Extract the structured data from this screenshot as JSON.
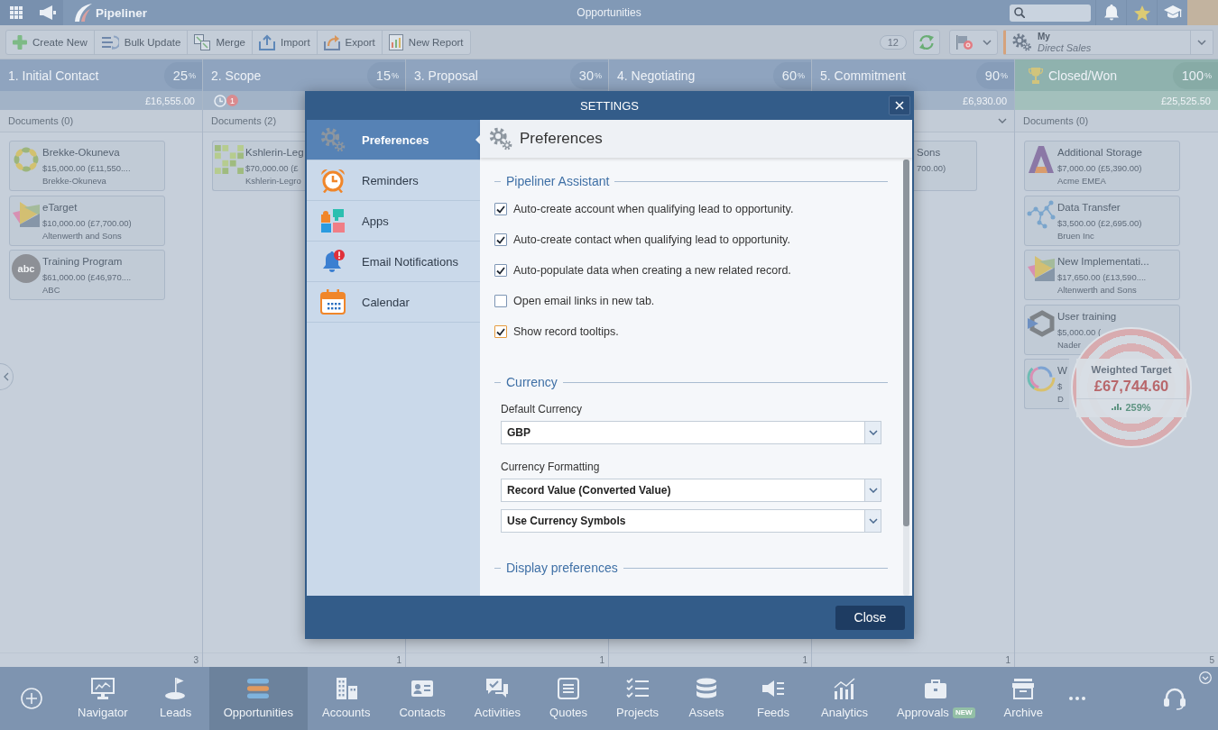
{
  "top_bar": {
    "logo": "Pipeliner",
    "title": "Opportunities"
  },
  "toolbar": {
    "buttons": [
      "Create New",
      "Bulk Update",
      "Merge",
      "Import",
      "Export",
      "New Report"
    ],
    "count": "12",
    "profile": {
      "title": "My",
      "subtitle": "Direct Sales"
    }
  },
  "columns": [
    {
      "kind": "stage",
      "name": "1. Initial Contact",
      "percent": "25",
      "percent_sign": "%",
      "total": "£16,555.00",
      "documents": "Documents (0)",
      "documents_toggle": false,
      "count": "3",
      "cards": [
        {
          "kind": "full",
          "title": "Brekke-Okuneva",
          "amount": "$15,000.00 (£11,550....",
          "account": "Brekke-Okuneva"
        },
        {
          "kind": "full",
          "title": "eTarget",
          "amount": "$10,000.00 (£7,700.00)",
          "account": "Altenwerth and Sons"
        },
        {
          "kind": "full",
          "logo_text": "abc",
          "title": "Training Program",
          "amount": "$61,000.00 (£46,970....",
          "account": "ABC"
        }
      ]
    },
    {
      "kind": "stage",
      "name": "2. Scope",
      "percent": "15",
      "percent_sign": "%",
      "alerts": "1",
      "documents": "Documents (2)",
      "count": "1",
      "cards": [
        {
          "kind": "cut-right",
          "title": "Kshlerin-Leg",
          "amount": "$70,000.00 (£",
          "account": "Kshlerin-Legro"
        }
      ]
    },
    {
      "kind": "stage",
      "name": "3. Proposal",
      "percent": "30",
      "percent_sign": "%",
      "count": "1"
    },
    {
      "kind": "stage",
      "name": "4. Negotiating",
      "percent": "60",
      "percent_sign": "%",
      "count": "1"
    },
    {
      "kind": "stage",
      "name": "5. Commitment",
      "percent": "90",
      "percent_sign": "%",
      "total": "£6,930.00",
      "documents_toggle": true,
      "count": "1",
      "cards": [
        {
          "kind": "cut-left",
          "title": "Sons",
          "amount": "700.00)"
        }
      ]
    },
    {
      "kind": "won",
      "name": "Closed/Won",
      "percent": "100",
      "percent_sign": "%",
      "total": "£25,525.50",
      "documents": "Documents (0)",
      "documents_toggle": false,
      "count": "5",
      "cards": [
        {
          "kind": "full",
          "title": "Additional Storage",
          "amount": "$7,000.00 (£5,390.00)",
          "account": "Acme EMEA"
        },
        {
          "kind": "full",
          "title": "Data Transfer",
          "amount": "$3,500.00 (£2,695.00)",
          "account": "Bruen Inc"
        },
        {
          "kind": "full",
          "title": "New Implementati...",
          "amount": "$17,650.00 (£13,590....",
          "account": "Altenwerth and Sons"
        },
        {
          "kind": "full",
          "title": "User training",
          "amount": "$5,000.00 (",
          "account": "Nader"
        },
        {
          "kind": "covered",
          "title": "W",
          "amount": "$",
          "account": "D"
        }
      ]
    }
  ],
  "weighted_target": {
    "title": "Weighted Target",
    "value": "£67,744.60",
    "percent": "259%"
  },
  "dialog": {
    "title": "SETTINGS",
    "nav": [
      {
        "label": "Preferences",
        "selected": true
      },
      {
        "label": "Reminders",
        "selected": false
      },
      {
        "label": "Apps",
        "selected": false
      },
      {
        "label": "Email Notifications",
        "selected": false
      },
      {
        "label": "Calendar",
        "selected": false
      }
    ],
    "panel_title": "Preferences",
    "sections": [
      {
        "title": "Pipeliner Assistant",
        "items": [
          {
            "kind": "checkbox",
            "label": "Auto-create account when qualifying lead to opportunity.",
            "checked": true
          },
          {
            "kind": "checkbox",
            "label": "Auto-create contact when qualifying lead to opportunity.",
            "checked": true
          },
          {
            "kind": "checkbox",
            "label": "Auto-populate data when creating a new related record.",
            "checked": true
          },
          {
            "kind": "checkbox",
            "label": "Open email links in new tab.",
            "checked": false
          },
          {
            "kind": "checkbox",
            "label": "Show record tooltips.",
            "checked": true,
            "focused": true
          }
        ]
      },
      {
        "title": "Currency",
        "items": [
          {
            "kind": "select",
            "label": "Default Currency",
            "value": "GBP"
          },
          {
            "kind": "select",
            "label": "Currency Formatting",
            "value": "Record Value (Converted Value)"
          },
          {
            "kind": "select",
            "value": "Use Currency Symbols"
          }
        ]
      },
      {
        "title": "Display preferences"
      }
    ],
    "close_button": "Close"
  },
  "bottom_nav": {
    "items": [
      {
        "label": "Navigator",
        "selected": false
      },
      {
        "label": "Leads",
        "selected": false
      },
      {
        "label": "Opportunities",
        "selected": true
      },
      {
        "label": "Accounts",
        "selected": false
      },
      {
        "label": "Contacts",
        "selected": false
      },
      {
        "label": "Activities",
        "selected": false
      },
      {
        "label": "Quotes",
        "selected": false
      },
      {
        "label": "Projects",
        "selected": false
      },
      {
        "label": "Assets",
        "selected": false
      },
      {
        "label": "Feeds",
        "selected": false
      },
      {
        "label": "Analytics",
        "selected": false
      },
      {
        "label": "Approvals",
        "badge": "NEW",
        "selected": false
      },
      {
        "label": "Archive",
        "selected": false
      }
    ]
  }
}
